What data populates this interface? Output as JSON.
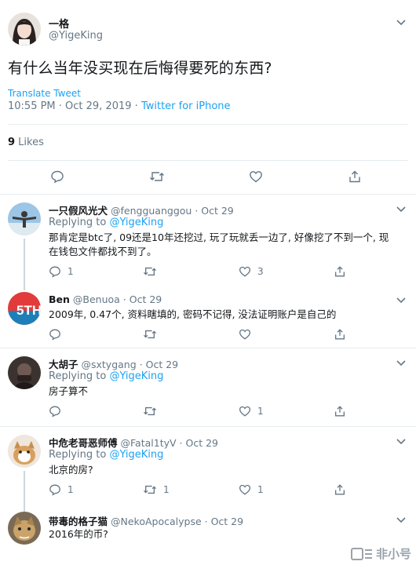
{
  "main": {
    "name": "一格",
    "handle": "@YigeKing",
    "text": "有什么当年没买现在后悔得要死的东西?",
    "translate": "Translate Tweet",
    "timestamp": "10:55 PM · Oct 29, 2019 · ",
    "source": "Twitter for iPhone",
    "likes_count": "9",
    "likes_label": " Likes"
  },
  "replies": [
    {
      "name": "一只假风光犬",
      "handle": "@fengguanggou",
      "date": "· Oct 29",
      "replying_prefix": "Replying to ",
      "replying_to": "@YigeKing",
      "text": "那肯定是btc了, 09还是10年还挖过, 玩了玩就丢一边了, 好像挖了不到一个, 现在钱包文件都找不到了。",
      "reply_count": "1",
      "retweet_count": "",
      "like_count": "3"
    },
    {
      "name": "Ben",
      "handle": "@Benuoa",
      "date": "· Oct 29",
      "text": "2009年, 0.47个, 资料瞎填的, 密码不记得, 没法证明账户是自己的",
      "reply_count": "",
      "retweet_count": "",
      "like_count": ""
    },
    {
      "name": "大胡子",
      "handle": "@sxtygang",
      "date": "· Oct 29",
      "replying_prefix": "Replying to ",
      "replying_to": "@YigeKing",
      "text": "房子算不",
      "reply_count": "",
      "retweet_count": "",
      "like_count": "1"
    },
    {
      "name": "中危老哥恶师傅",
      "handle": "@Fatal1tyV",
      "date": "· Oct 29",
      "replying_prefix": "Replying to ",
      "replying_to": "@YigeKing",
      "text": "北京的房?",
      "reply_count": "1",
      "retweet_count": "1",
      "like_count": "1"
    },
    {
      "name": "带毒的格子猫",
      "handle": "@NekoApocalypse",
      "date": "· Oct 29",
      "text": "2016年的币?"
    }
  ],
  "ben_avatar_text": "5TH",
  "watermark": "非小号",
  "icons": {
    "reply": "reply-icon",
    "retweet": "retweet-icon",
    "like": "like-icon",
    "share": "share-icon",
    "more": "chevron-down-icon"
  },
  "colors": {
    "accent": "#1da1f2",
    "muted": "#657786",
    "text": "#14171a",
    "border": "#e6ecf0"
  }
}
